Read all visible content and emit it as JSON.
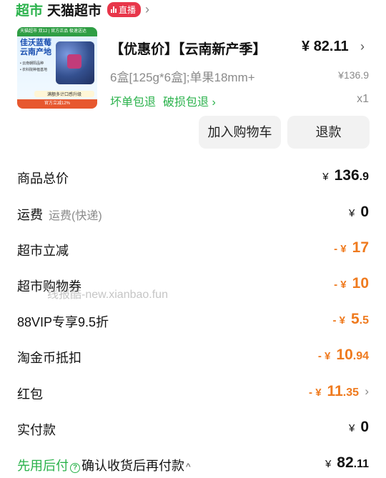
{
  "store": {
    "logo_text": "超市",
    "name": "天猫超市",
    "live_badge": "直播",
    "chevron": "›"
  },
  "product": {
    "image": {
      "topbar": "天猫超市 双12 | 官方正品 极速送达",
      "title_line1": "佳沃蓝莓",
      "title_line2": "云南产地",
      "tag1": "• 云南朝阳品种",
      "tag2": "• 农科院种植基地",
      "caption": "满额多计口感升级",
      "footer": "官方立减12%"
    },
    "title": "【优惠价】【云南新产季】",
    "price_symbol": "¥",
    "price": "82.11",
    "spec": "6盒[125g*6盒];单果18mm+",
    "original_price": "¥136.9",
    "service_tags": [
      "坏单包退",
      "破损包退 ›"
    ],
    "quantity": "x1"
  },
  "actions": {
    "add_to_cart": "加入购物车",
    "refund": "退款"
  },
  "summary": {
    "total": {
      "label": "商品总价",
      "currency": "¥",
      "int": "136",
      "dec": ".9"
    },
    "shipping": {
      "label": "运费",
      "sub": "运费(快递)",
      "currency": "¥",
      "int": "0",
      "dec": ""
    },
    "supermarket_discount": {
      "label": "超市立减",
      "sign": "-",
      "currency": "¥",
      "int": "17",
      "dec": ""
    },
    "coupon": {
      "label": "超市购物券",
      "sign": "-",
      "currency": "¥",
      "int": "10",
      "dec": ""
    },
    "vip": {
      "label": "88VIP专享9.5折",
      "sign": "-",
      "currency": "¥",
      "int": "5",
      "dec": ".5"
    },
    "taojinbi": {
      "label": "淘金币抵扣",
      "sign": "-",
      "currency": "¥",
      "int": "10",
      "dec": ".94"
    },
    "red_packet": {
      "label": "红包",
      "sign": "-",
      "currency": "¥",
      "int": "11",
      "dec": ".35"
    },
    "paid": {
      "label": "实付款",
      "currency": "¥",
      "int": "0",
      "dec": ""
    }
  },
  "watermark": "线报酷-new.xianbao.fun",
  "bnpl": {
    "green_text": "先用后付",
    "info_icon": "?",
    "text": "确认收货后再付款",
    "caret": "^",
    "currency": "¥",
    "int": "82",
    "dec": ".11"
  },
  "colors": {
    "brand_green": "#2ab24b",
    "discount_orange": "#ef7a1e",
    "live_red": "#e8364a"
  }
}
